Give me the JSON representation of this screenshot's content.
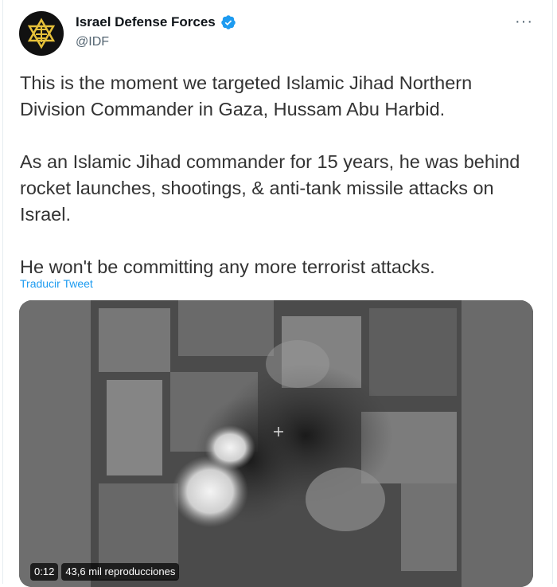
{
  "account": {
    "display_name": "Israel Defense Forces",
    "handle": "@IDF",
    "verified": true,
    "avatar_icon": "idf-emblem-icon"
  },
  "more_icon_text": "···",
  "tweet": {
    "paragraphs": [
      "This is the moment we targeted Islamic Jihad Northern Division Commander in Gaza, Hussam Abu Harbid.",
      "As an Islamic Jihad commander for 15 years, he was behind rocket launches, shootings, & anti-tank missile attacks on Israel.",
      "He won't be committing any more terrorist attacks."
    ],
    "translate_label": "Traducir Tweet"
  },
  "video": {
    "duration": "0:12",
    "views": "43,6 mil reproducciones"
  },
  "colors": {
    "link": "#1d9bf0",
    "verified": "#1d9bf0",
    "text": "#333333",
    "secondary": "#536471"
  }
}
